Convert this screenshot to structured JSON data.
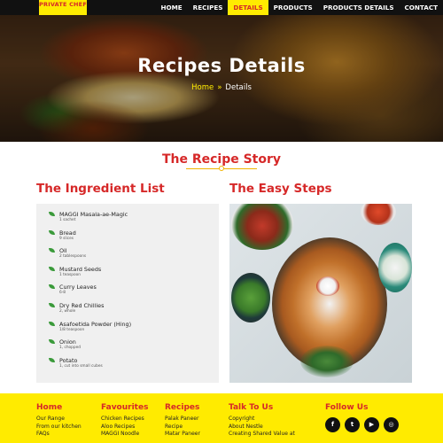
{
  "brand": {
    "logo_text": "PRIVATE CHEF"
  },
  "nav": {
    "items": [
      {
        "label": "HOME",
        "active": false
      },
      {
        "label": "RECIPES",
        "active": false
      },
      {
        "label": "DETAILS",
        "active": true
      },
      {
        "label": "PRODUCTS",
        "active": false
      },
      {
        "label": "PRODUCTS DETAILS",
        "active": false
      },
      {
        "label": "CONTACT",
        "active": false
      }
    ]
  },
  "hero": {
    "title": "Recipes Details",
    "breadcrumb": {
      "home": "Home",
      "separator": "»",
      "current": "Details"
    }
  },
  "story": {
    "title": "The Recipe Story"
  },
  "ingredients": {
    "heading": "The Ingredient List",
    "items": [
      {
        "name": "MAGGI Masala-ae-Magic",
        "qty": "1 sachet"
      },
      {
        "name": "Bread",
        "qty": "9 slices"
      },
      {
        "name": "Oil",
        "qty": "2 tablespoons"
      },
      {
        "name": "Mustard Seeds",
        "qty": "1 teaspoon"
      },
      {
        "name": "Curry Leaves",
        "qty": "6-8"
      },
      {
        "name": "Dry Red Chillies",
        "qty": "2, whole"
      },
      {
        "name": "Asafoetida Powder (Hing)",
        "qty": "1/8 teaspoon"
      },
      {
        "name": "Onion",
        "qty": "1, chopped"
      },
      {
        "name": "Potato",
        "qty": "1, cut into small cubes"
      }
    ]
  },
  "steps": {
    "heading": "The Easy Steps"
  },
  "footer": {
    "columns": [
      {
        "heading": "Home",
        "links": [
          "Our Range",
          "From our kitchen",
          "FAQs"
        ]
      },
      {
        "heading": "Favourites",
        "links": [
          "Chicken Recipes",
          "Aloo Recipes",
          "MAGGI Noodle"
        ]
      },
      {
        "heading": "Recipes",
        "links": [
          "Palak Paneer",
          "Recipe",
          "Matar Paneer"
        ]
      },
      {
        "heading": "Talk To Us",
        "links": [
          "Copyright",
          "About Nestle",
          "Creating Shared Value at"
        ]
      }
    ],
    "follow": {
      "heading": "Follow Us",
      "icons": [
        {
          "name": "facebook-icon",
          "glyph": "f"
        },
        {
          "name": "twitter-icon",
          "glyph": "t"
        },
        {
          "name": "youtube-icon",
          "glyph": "▶"
        },
        {
          "name": "instagram-icon",
          "glyph": "◎"
        }
      ]
    }
  },
  "colors": {
    "accent_yellow": "#ffeb00",
    "accent_red": "#d62828",
    "nav_bg": "#111111"
  }
}
